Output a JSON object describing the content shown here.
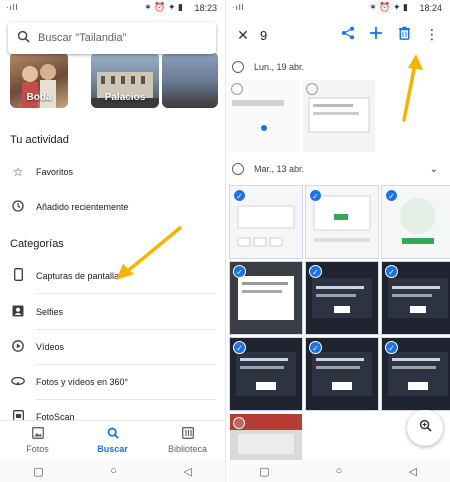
{
  "left": {
    "status": {
      "time": "18:23",
      "signal": "·ıll",
      "icons": "✶ ⏰ ✦ ▮"
    },
    "search": {
      "placeholder": "Buscar \"Tailandia\""
    },
    "albums": [
      {
        "label": "Boda"
      },
      {
        "label": "Palacios"
      },
      {
        "label": ""
      }
    ],
    "activity_title": "Tu actividad",
    "activity": [
      {
        "icon": "star-icon",
        "label": "Favoritos"
      },
      {
        "icon": "history-icon",
        "label": "Añadido recientemente"
      }
    ],
    "categories_title": "Categorías",
    "categories": [
      {
        "icon": "phone-icon",
        "label": "Capturas de pantalla"
      },
      {
        "icon": "selfie-icon",
        "label": "Selfies"
      },
      {
        "icon": "play-icon",
        "label": "Vídeos"
      },
      {
        "icon": "panorama-icon",
        "label": "Fotos y vídeos en 360°"
      },
      {
        "icon": "scan-icon",
        "label": "FotoScan"
      }
    ],
    "bottom_nav": [
      {
        "icon": "photo-icon",
        "label": "Fotos",
        "active": false
      },
      {
        "icon": "search-icon",
        "label": "Buscar",
        "active": true
      },
      {
        "icon": "library-icon",
        "label": "Biblioteca",
        "active": false
      }
    ],
    "arrow_color": "#F4B400"
  },
  "right": {
    "status": {
      "time": "18:24",
      "signal": "·ıll",
      "icons": "✶ ⏰ ✦ ▮"
    },
    "selected_count": "9",
    "actions": [
      "share-icon",
      "add-icon",
      "trash-icon",
      "more-icon"
    ],
    "groups": [
      {
        "date": "Lun., 19 abr.",
        "selected": false
      },
      {
        "date": "Mar., 13 abr.",
        "selected": false
      }
    ],
    "accent": "#1A73E8",
    "arrow_color": "#F4B400"
  }
}
